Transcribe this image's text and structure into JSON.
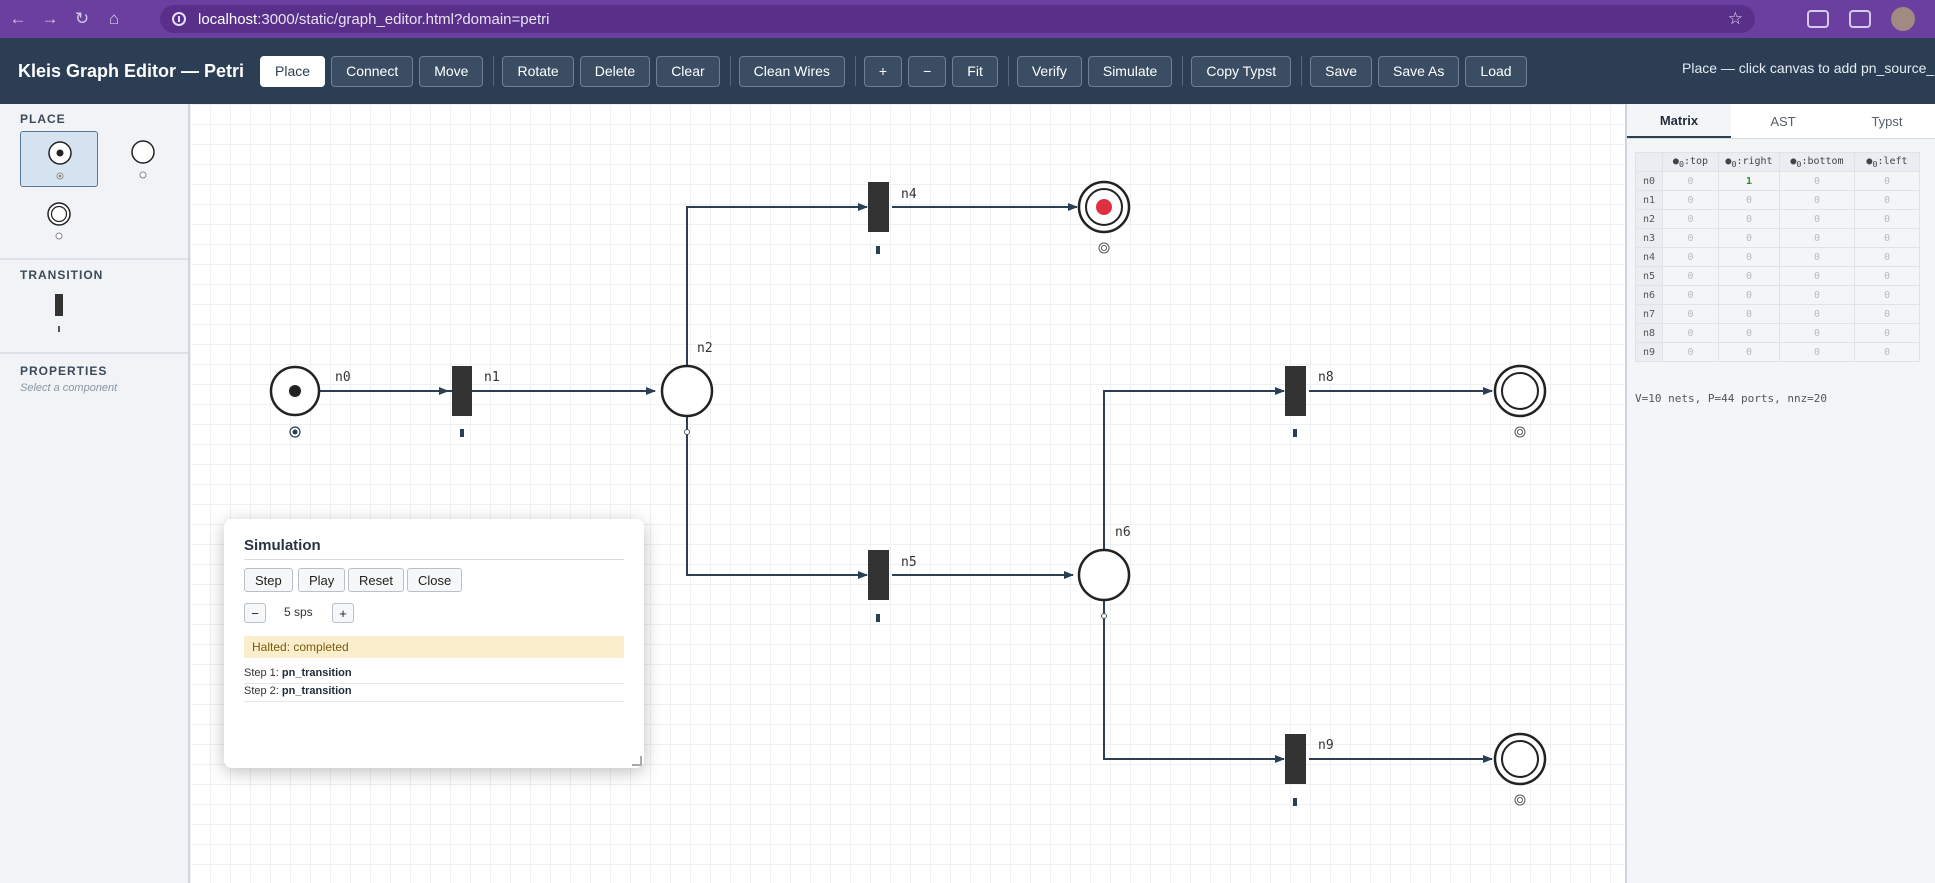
{
  "browser": {
    "url_host": "localhost",
    "url_rest": ":3000/static/graph_editor.html?domain=petri",
    "icons": [
      "back-icon",
      "forward-icon",
      "reload-icon",
      "home-icon",
      "star-icon",
      "extension-icon",
      "tab-search-icon",
      "profile-avatar"
    ]
  },
  "toolbar": {
    "title": "Kleis Graph Editor — Petri",
    "buttons": {
      "place": "Place",
      "connect": "Connect",
      "move": "Move",
      "rotate": "Rotate",
      "delete": "Delete",
      "clear": "Clear",
      "clean_wires": "Clean Wires",
      "zoom_in": "+",
      "zoom_out": "−",
      "fit": "Fit",
      "verify": "Verify",
      "simulate": "Simulate",
      "copy_typst": "Copy Typst",
      "save": "Save",
      "save_as": "Save As",
      "load": "Load"
    },
    "active_tool": "Place",
    "status": "Place — click canvas to add pn_source_place"
  },
  "left_panel": {
    "place_header": "PLACE",
    "transition_header": "TRANSITION",
    "properties_header": "PROPERTIES",
    "properties_hint": "Select a component"
  },
  "canvas": {
    "nodes": [
      {
        "id": "n0",
        "kind": "source-place"
      },
      {
        "id": "n1",
        "kind": "transition"
      },
      {
        "id": "n2",
        "kind": "place"
      },
      {
        "id": "n4",
        "kind": "transition"
      },
      {
        "id": "n5",
        "kind": "transition"
      },
      {
        "id": "n6",
        "kind": "place"
      },
      {
        "id": "n8",
        "kind": "transition"
      },
      {
        "id": "n9",
        "kind": "transition"
      },
      {
        "id": "sink-top",
        "kind": "sink-place-marked"
      },
      {
        "id": "sink-mid",
        "kind": "sink-place"
      },
      {
        "id": "sink-bottom",
        "kind": "sink-place"
      }
    ],
    "colors": {
      "wire": "#2c3e54",
      "token_sink": "#e03040",
      "node": "#333333"
    }
  },
  "simulation": {
    "title": "Simulation",
    "buttons": {
      "step": "Step",
      "play": "Play",
      "reset": "Reset",
      "close": "Close"
    },
    "speed_minus": "−",
    "speed_plus": "+",
    "speed": "5 sps",
    "status": "Halted: completed",
    "log": [
      {
        "prefix": "Step 1: ",
        "name": "pn_transition"
      },
      {
        "prefix": "Step 2: ",
        "name": "pn_transition"
      }
    ]
  },
  "right_panel": {
    "tabs": {
      "matrix": "Matrix",
      "ast": "AST",
      "typst": "Typst"
    },
    "matrix": {
      "columns": [
        {
          "base": "●",
          "sub": "0",
          "name": ":top"
        },
        {
          "base": "●",
          "sub": "0",
          "name": ":right"
        },
        {
          "base": "●",
          "sub": "0",
          "name": ":bottom"
        },
        {
          "base": "●",
          "sub": "0",
          "name": ":left"
        }
      ],
      "rows": [
        {
          "label": "n0",
          "values": [
            "0",
            "1",
            "0",
            "0"
          ]
        },
        {
          "label": "n1",
          "values": [
            "0",
            "0",
            "0",
            "0"
          ]
        },
        {
          "label": "n2",
          "values": [
            "0",
            "0",
            "0",
            "0"
          ]
        },
        {
          "label": "n3",
          "values": [
            "0",
            "0",
            "0",
            "0"
          ]
        },
        {
          "label": "n4",
          "values": [
            "0",
            "0",
            "0",
            "0"
          ]
        },
        {
          "label": "n5",
          "values": [
            "0",
            "0",
            "0",
            "0"
          ]
        },
        {
          "label": "n6",
          "values": [
            "0",
            "0",
            "0",
            "0"
          ]
        },
        {
          "label": "n7",
          "values": [
            "0",
            "0",
            "0",
            "0"
          ]
        },
        {
          "label": "n8",
          "values": [
            "0",
            "0",
            "0",
            "0"
          ]
        },
        {
          "label": "n9",
          "values": [
            "0",
            "0",
            "0",
            "0"
          ]
        }
      ],
      "stats": "V=10 nets, P=44 ports, nnz=20"
    }
  }
}
